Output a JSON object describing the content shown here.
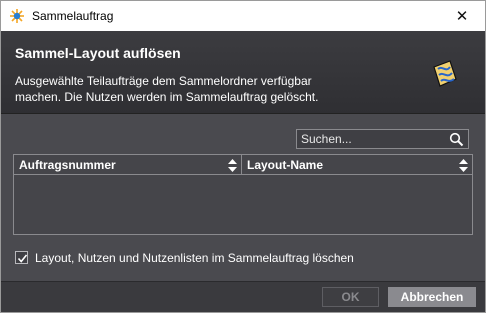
{
  "window": {
    "title": "Sammelauftrag",
    "close_icon": "close-icon"
  },
  "header": {
    "title": "Sammel-Layout auflösen",
    "description_line1": "Ausgewählte Teilaufträge dem Sammelordner verfügbar",
    "description_line2": "machen. Die Nutzen werden im Sammelauftrag gelöscht.",
    "icon": "unfold-layout-icon"
  },
  "search": {
    "placeholder": "Suchen...",
    "value": ""
  },
  "table": {
    "columns": [
      {
        "label": "Auftragsnummer",
        "sort_icon": "sort-arrows-icon"
      },
      {
        "label": "Layout-Name",
        "sort_icon": "sort-arrows-icon"
      }
    ],
    "rows": []
  },
  "option": {
    "label": "Layout, Nutzen und Nutzenlisten im Sammelauftrag löschen",
    "checked": true
  },
  "buttons": {
    "ok": "OK",
    "cancel": "Abbrechen"
  },
  "colors": {
    "header_bg": "#333337",
    "body_bg": "#4a4a4f",
    "button_bg": "#8a8a8f",
    "text": "#ffffff"
  }
}
